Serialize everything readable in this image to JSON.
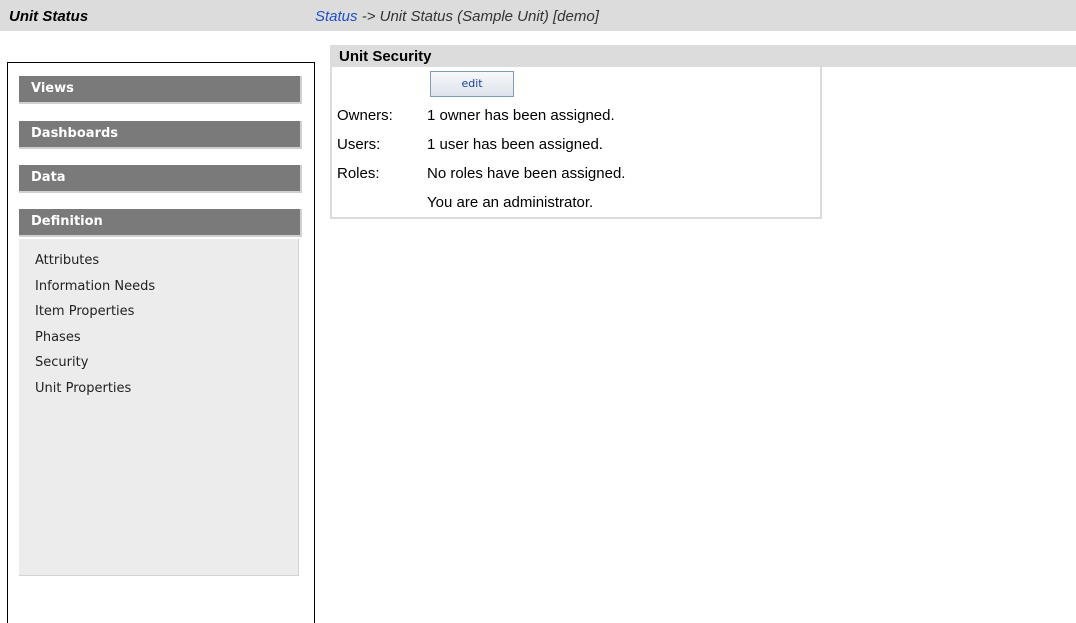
{
  "header": {
    "app_title": "Unit Status",
    "breadcrumb_link": "Status",
    "breadcrumb_rest": " -> Unit Status (Sample Unit) [demo]"
  },
  "sidebar": {
    "sections": [
      {
        "label": "Views"
      },
      {
        "label": "Dashboards"
      },
      {
        "label": "Data"
      },
      {
        "label": "Definition"
      }
    ],
    "definition_items": [
      "Attributes",
      "Information Needs",
      "Item Properties",
      "Phases",
      "Security",
      "Unit Properties"
    ]
  },
  "panel": {
    "title": "Unit Security",
    "edit_label": "edit",
    "owners_label": "Owners:",
    "owners_value": "1 owner has been assigned.",
    "users_label": "Users:",
    "users_value": "1 user has been assigned.",
    "roles_label": "Roles:",
    "roles_value": "No roles have been assigned.",
    "admin_note": "You are an administrator."
  },
  "colors": {
    "link": "#1f4fcc",
    "nav_header_bg": "#7a7a7a",
    "topbar_bg": "#dcdcdc"
  }
}
